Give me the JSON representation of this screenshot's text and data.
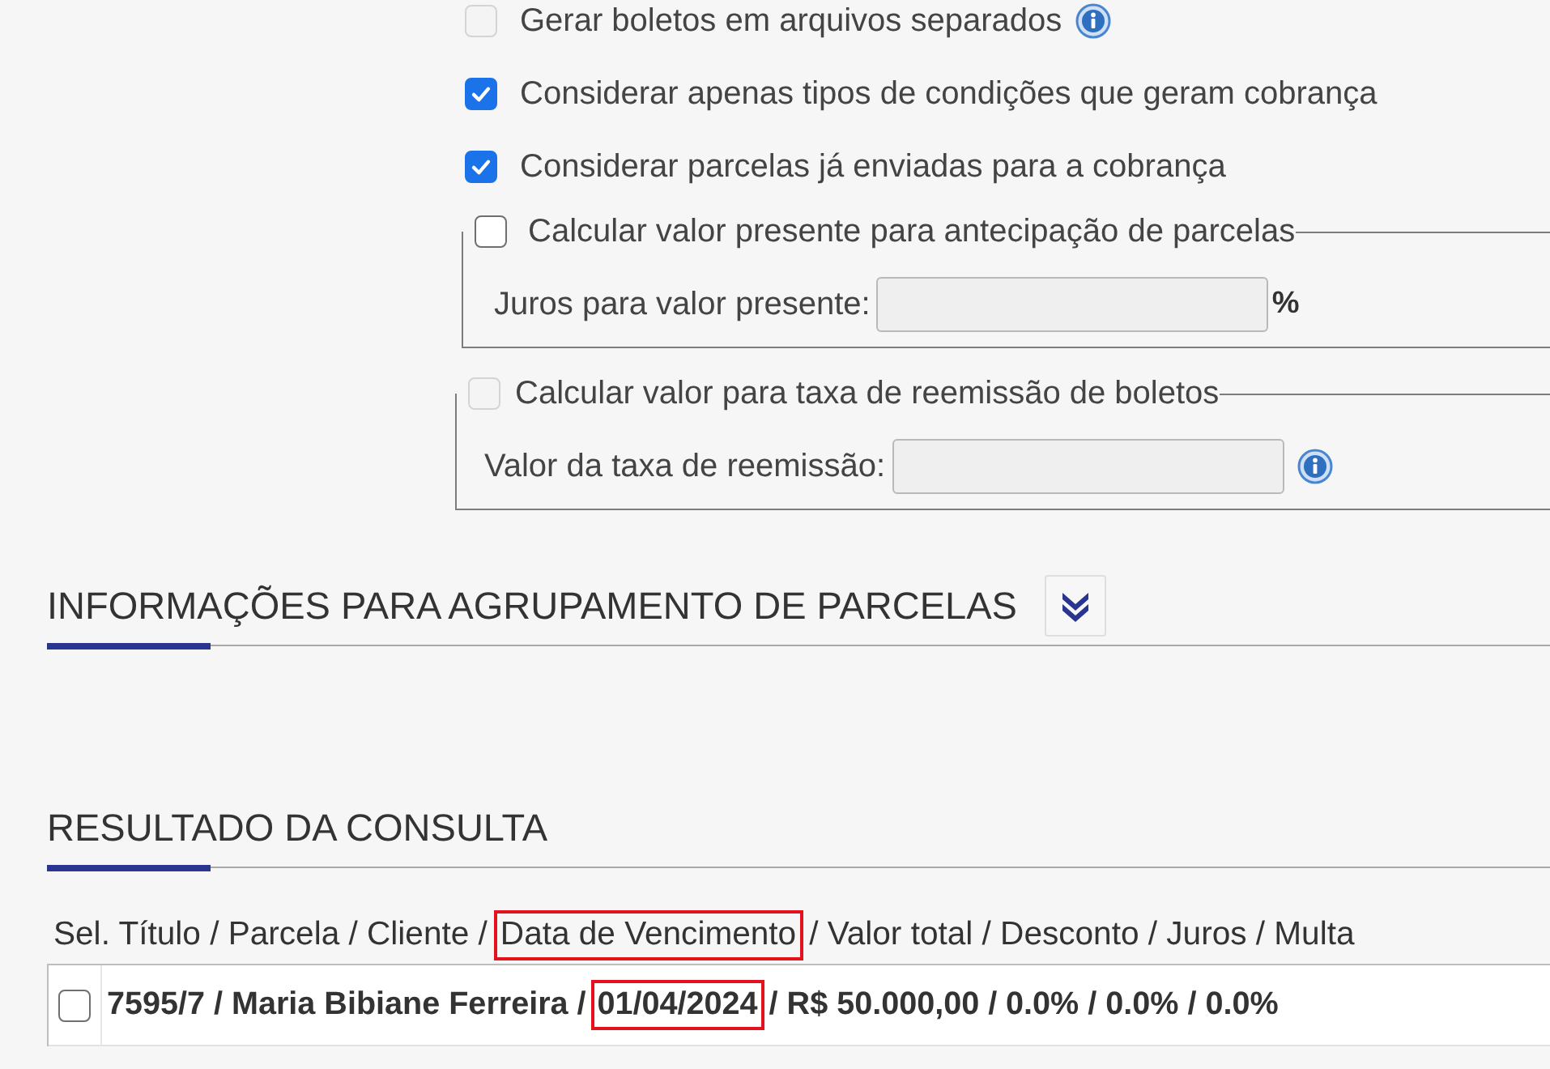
{
  "options": [
    {
      "label": "Gerar boletos em arquivos separados",
      "checked": false,
      "disabled": true,
      "info": true
    },
    {
      "label": "Considerar apenas tipos de condições que geram cobrança",
      "checked": true,
      "disabled": false,
      "info": false
    },
    {
      "label": "Considerar parcelas já enviadas para a cobrança",
      "checked": true,
      "disabled": false,
      "info": false
    }
  ],
  "fieldsets": [
    {
      "legend": "Calcular valor presente para antecipação de parcelas",
      "checked": false,
      "disabled": false,
      "field_label": "Juros para valor presente:",
      "input_disabled": true,
      "suffix": "%",
      "info": false
    },
    {
      "legend": "Calcular valor para taxa de reemissão de boletos",
      "checked": false,
      "disabled": true,
      "field_label": "Valor da taxa de reemissão:",
      "input_disabled": true,
      "info": true
    }
  ],
  "sections": [
    {
      "title": "INFORMAÇÕES PARA AGRUPAMENTO DE PARCELAS",
      "collapsible": true
    },
    {
      "title": "RESULTADO DA CONSULTA",
      "collapsible": false
    }
  ],
  "results": {
    "header": [
      {
        "text": "Sel. Título / Parcela / Cliente /",
        "highlighted": false
      },
      {
        "text": "Data de Vencimento",
        "highlighted": true
      },
      {
        "text": "/ Valor total / Desconto / Juros / Multa",
        "highlighted": false
      }
    ],
    "rows": [
      {
        "selected": false,
        "parts": [
          {
            "text": "7595/7 / Maria Bibiane Ferreira /",
            "highlighted": false
          },
          {
            "text": "01/04/2024",
            "highlighted": true
          },
          {
            "text": "/ R$ 50.000,00 / 0.0% / 0.0% / 0.0%",
            "highlighted": false
          }
        ]
      }
    ]
  }
}
